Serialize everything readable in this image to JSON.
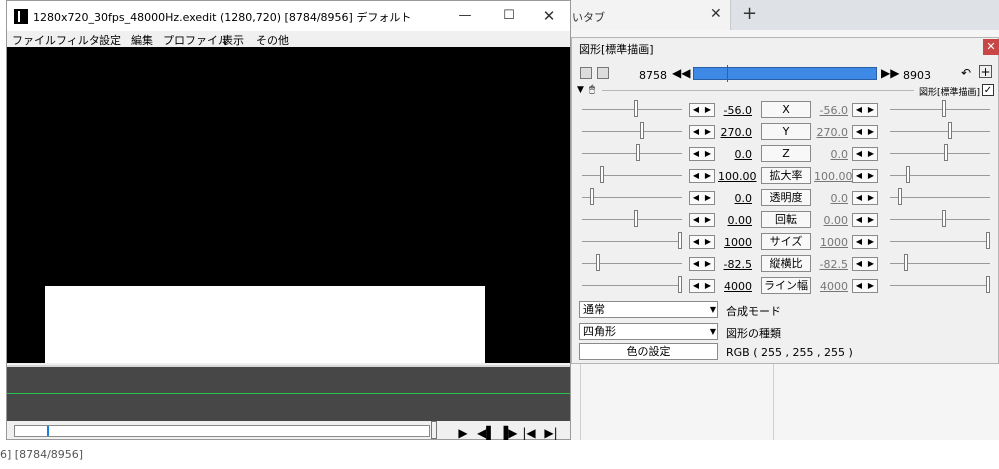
{
  "background": {
    "tab_title": "いタブ",
    "tab_close": "✕",
    "new_tab": "+",
    "status_text": "6] [8784/8956]"
  },
  "main_window": {
    "title": "1280x720_30fps_48000Hz.exedit (1280,720)  [8784/8956]  デフォルト",
    "min_icon": "—",
    "max_icon": "☐",
    "close_icon": "✕",
    "menu": [
      "ファイル",
      "フィルタ",
      "設定",
      "編集",
      "プロファイル",
      "表示",
      "その他"
    ],
    "transport": [
      "▶",
      "◀▌",
      "▐▶",
      "|◀",
      "▶|"
    ]
  },
  "panel": {
    "title": "図形[標準描画]",
    "close": "✕",
    "frame_start": "8758",
    "frame_end": "8903",
    "prev_icon": "◀◀",
    "next_icon": "▶▶",
    "undo_icon": "↶",
    "add_icon": "+",
    "tri_icon": "▼",
    "mouse_icon": "🖱",
    "object_name": "図形[標準描画]",
    "check": "✓",
    "arrow_left": "◀",
    "arrow_right": "▶",
    "params": [
      {
        "label": "X",
        "left": "-56.0",
        "right": "-56.0"
      },
      {
        "label": "Y",
        "left": "270.0",
        "right": "270.0"
      },
      {
        "label": "Z",
        "left": "0.0",
        "right": "0.0"
      },
      {
        "label": "拡大率",
        "left": "100.00",
        "right": "100.00"
      },
      {
        "label": "透明度",
        "left": "0.0",
        "right": "0.0"
      },
      {
        "label": "回転",
        "left": "0.00",
        "right": "0.00"
      },
      {
        "label": "サイズ",
        "left": "1000",
        "right": "1000"
      },
      {
        "label": "縦横比",
        "left": "-82.5",
        "right": "-82.5"
      },
      {
        "label": "ライン幅",
        "left": "4000",
        "right": "4000"
      }
    ],
    "blend_mode_value": "通常",
    "blend_mode_label": "合成モード",
    "shape_value": "四角形",
    "shape_label": "図形の種類",
    "combo_arrow": "▼",
    "color_button": "色の設定",
    "rgb_text": "RGB ( 255 , 255 , 255 )"
  }
}
